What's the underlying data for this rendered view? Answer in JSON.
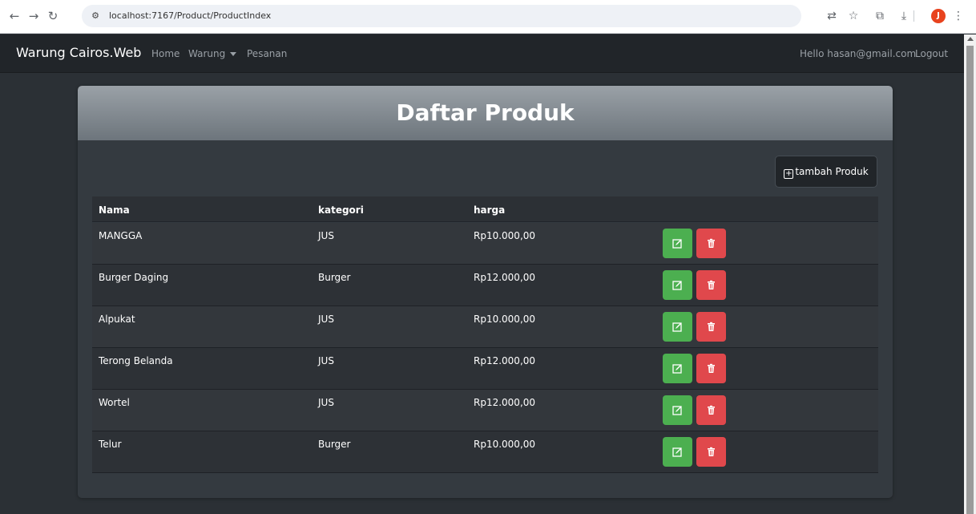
{
  "browser": {
    "url": "localhost:7167/Product/ProductIndex",
    "icons": [
      "back-icon",
      "forward-icon",
      "reload-icon",
      "site-info-icon",
      "translate-icon",
      "star-icon",
      "extensions-icon",
      "download-icon",
      "profile-avatar",
      "menu-icon"
    ],
    "profile_initial": "J"
  },
  "navbar": {
    "brand": "Warung Cairos.Web",
    "links": [
      "Home",
      "Warung",
      "Pesanan"
    ],
    "greeting": "Hello hasan@gmail.com",
    "logout": "Logout"
  },
  "page": {
    "title": "Daftar Produk",
    "add_button": "tambah Produk"
  },
  "table": {
    "headers": [
      "Nama",
      "kategori",
      "harga"
    ],
    "rows": [
      {
        "nama": "MANGGA",
        "kategori": "JUS",
        "harga": "Rp10.000,00"
      },
      {
        "nama": "Burger Daging",
        "kategori": "Burger",
        "harga": "Rp12.000,00"
      },
      {
        "nama": "Alpukat",
        "kategori": "JUS",
        "harga": "Rp10.000,00"
      },
      {
        "nama": "Terong Belanda",
        "kategori": "JUS",
        "harga": "Rp12.000,00"
      },
      {
        "nama": "Wortel",
        "kategori": "JUS",
        "harga": "Rp12.000,00"
      },
      {
        "nama": "Telur",
        "kategori": "Burger",
        "harga": "Rp10.000,00"
      }
    ]
  },
  "colors": {
    "edit": "#4caf50",
    "delete": "#e0484c",
    "navbar": "#212529",
    "card": "#343a40"
  }
}
